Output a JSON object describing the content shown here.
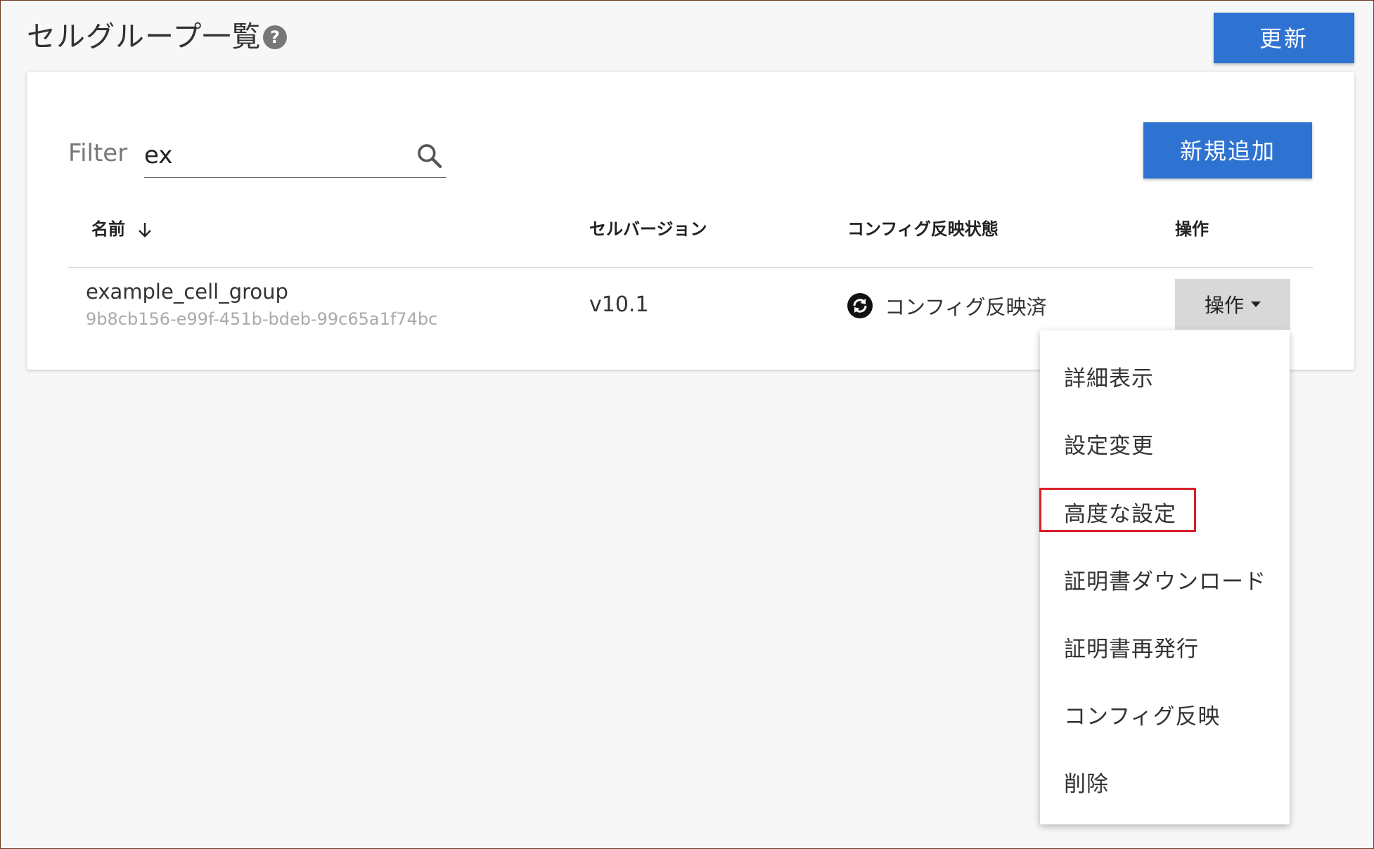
{
  "header": {
    "title": "セルグループ一覧",
    "help_icon": "?",
    "refresh_label": "更新"
  },
  "card": {
    "filter_label": "Filter",
    "filter_value": "ex",
    "new_label": "新規追加",
    "columns": {
      "name": "名前",
      "version": "セルバージョン",
      "config": "コンフィグ反映状態",
      "actions": "操作"
    },
    "row": {
      "name": "example_cell_group",
      "id": "9b8cb156-e99f-451b-bdeb-99c65a1f74bc",
      "version": "v10.1",
      "status": "コンフィグ反映済",
      "action_label": "操作"
    }
  },
  "menu": {
    "items": [
      "詳細表示",
      "設定変更",
      "高度な設定",
      "証明書ダウンロード",
      "証明書再発行",
      "コンフィグ反映",
      "削除"
    ],
    "highlighted_index": 2,
    "highlight_color": "#d9202a"
  },
  "colors": {
    "primary": "#2f73d2",
    "action_bg": "#d8d8d8"
  }
}
